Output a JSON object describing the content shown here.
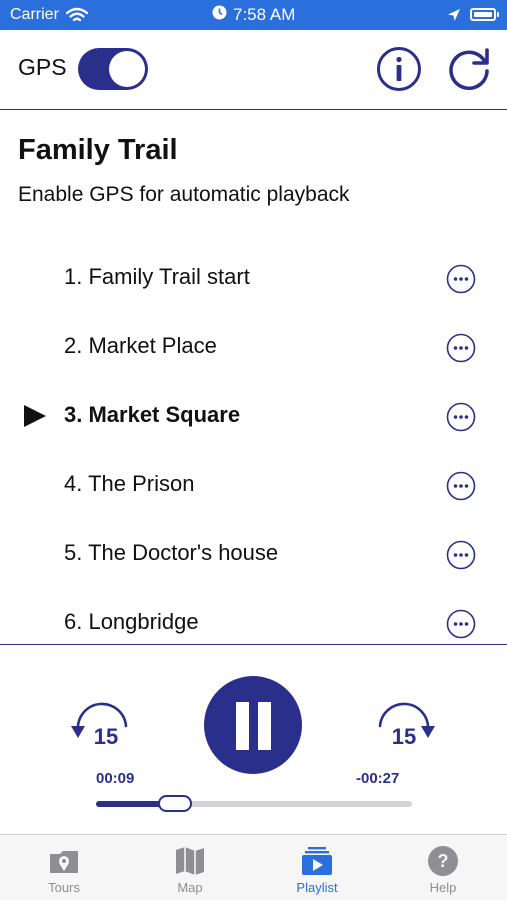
{
  "status_bar": {
    "carrier": "Carrier",
    "time": "7:58 AM"
  },
  "header": {
    "gps_label": "GPS",
    "gps_enabled": true
  },
  "trail": {
    "title": "Family Trail",
    "subtitle": "Enable GPS for automatic playback"
  },
  "playlist": {
    "items": [
      {
        "label": "1. Family Trail start",
        "playing": false
      },
      {
        "label": "2. Market Place",
        "playing": false
      },
      {
        "label": "3. Market Square",
        "playing": true
      },
      {
        "label": "4. The Prison",
        "playing": false
      },
      {
        "label": "5. The Doctor's house",
        "playing": false
      },
      {
        "label": "6. Longbridge",
        "playing": false
      }
    ]
  },
  "player": {
    "skip_back_seconds": "15",
    "skip_forward_seconds": "15",
    "elapsed": "00:09",
    "remaining": "-00:27",
    "progress": 0.25,
    "state": "playing"
  },
  "tabs": [
    {
      "label": "Tours",
      "icon": "tours-icon",
      "selected": false
    },
    {
      "label": "Map",
      "icon": "map-icon",
      "selected": false
    },
    {
      "label": "Playlist",
      "icon": "playlist-icon",
      "selected": true
    },
    {
      "label": "Help",
      "icon": "help-icon",
      "selected": false
    }
  ],
  "colors": {
    "accent": "#2b2f8c",
    "status_bar": "#2a6fdc",
    "tab_selected": "#2a6fdc",
    "tab_inactive": "#8e8e93"
  }
}
